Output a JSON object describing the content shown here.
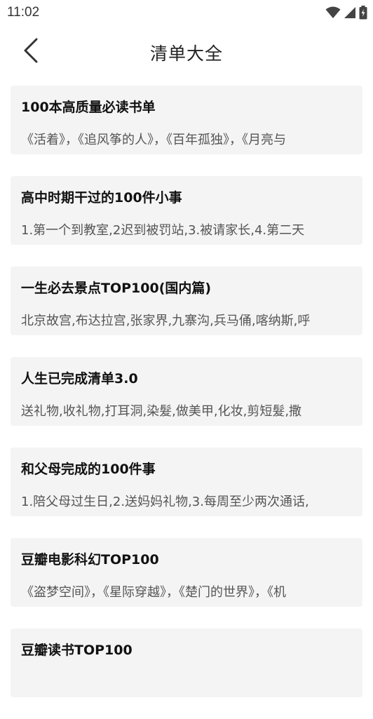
{
  "status_bar": {
    "time": "11:02",
    "icons": [
      "wifi-icon",
      "cellular-signal-icon",
      "battery-charging-icon"
    ]
  },
  "header": {
    "title": "清单大全",
    "back_icon": "chevron-left-icon"
  },
  "lists": [
    {
      "title": "100本高质量必读书单",
      "description": "《活着》，《追风筝的人》，《百年孤独》，《月亮与"
    },
    {
      "title": "高中时期干过的100件小事",
      "description": "1.第一个到教室,2迟到被罚站,3.被请家长,4.第二天"
    },
    {
      "title": "一生必去景点TOP100(国内篇)",
      "description": "北京故宫,布达拉宫,张家界,九寨沟,兵马俑,喀纳斯,呼"
    },
    {
      "title": "人生已完成清单3.0",
      "description": "送礼物,收礼物,打耳洞,染髮,做美甲,化妆,剪短髮,撒"
    },
    {
      "title": "和父母完成的100件事",
      "description": "1.陪父母过生日,2.送妈妈礼物,3.每周至少两次通话,"
    },
    {
      "title": "豆瓣电影科幻TOP100",
      "description": "《盗梦空间》，《星际穿越》，《楚门的世界》，《机"
    },
    {
      "title": "豆瓣读书TOP100",
      "description": ""
    }
  ]
}
